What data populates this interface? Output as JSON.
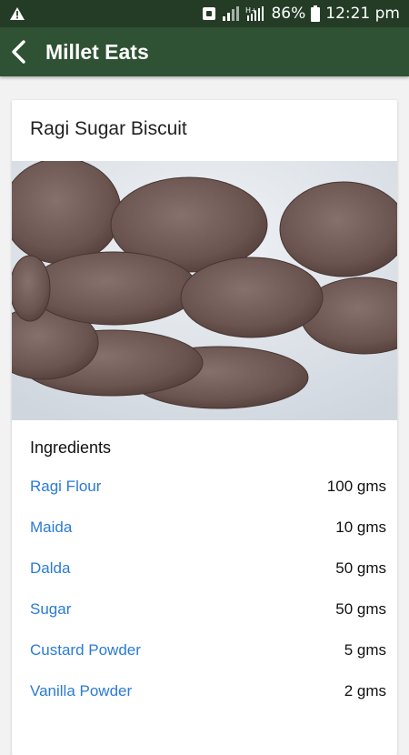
{
  "status_bar": {
    "battery": "86%",
    "time": "12:21 pm",
    "icons": [
      "warning-icon",
      "notification-icon",
      "signal-icon",
      "hplus-signal-icon",
      "battery-icon"
    ]
  },
  "app_bar": {
    "title": "Millet Eats",
    "back_icon": "back-arrow-icon"
  },
  "recipe": {
    "title": "Ragi Sugar Biscuit",
    "image": "ragi-biscuits-photo",
    "ingredients_heading": "Ingredients",
    "ingredients": [
      {
        "name": "Ragi Flour",
        "qty": "100 gms"
      },
      {
        "name": "Maida",
        "qty": "10 gms"
      },
      {
        "name": "Dalda",
        "qty": "50 gms"
      },
      {
        "name": "Sugar",
        "qty": "50 gms"
      },
      {
        "name": "Custard Powder",
        "qty": "5 gms"
      },
      {
        "name": "Vanilla Powder",
        "qty": "2 gms"
      }
    ]
  },
  "colors": {
    "status_bar": "#243c26",
    "app_bar": "#2e5233",
    "ingredient_link": "#2b7bd6"
  }
}
